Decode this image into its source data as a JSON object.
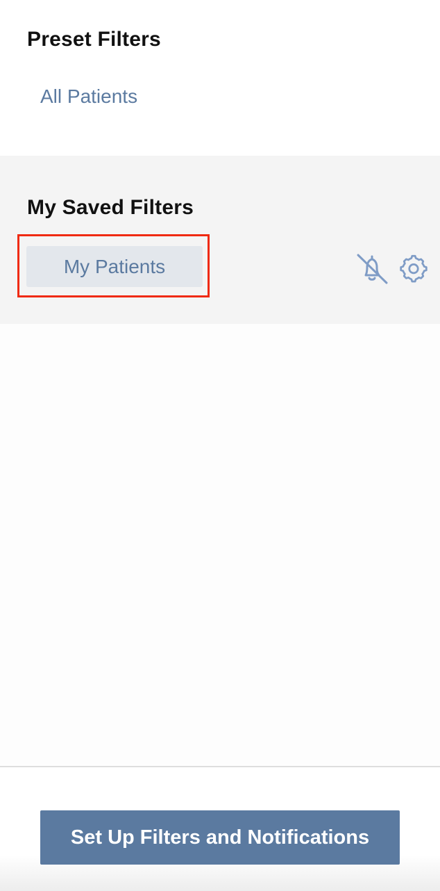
{
  "preset": {
    "title": "Preset Filters",
    "items": [
      {
        "label": "All Patients"
      }
    ]
  },
  "saved": {
    "title": "My Saved Filters",
    "items": [
      {
        "label": "My Patients",
        "notifications": "off",
        "icons": [
          "bell-off-icon",
          "gear-icon"
        ]
      }
    ]
  },
  "footer": {
    "button_label": "Set Up Filters and Notifications"
  },
  "colors": {
    "accent": "#5b7aa0",
    "highlight": "#ef2a12",
    "chip_bg": "#e3e7ec",
    "section_bg": "#f4f4f4"
  }
}
